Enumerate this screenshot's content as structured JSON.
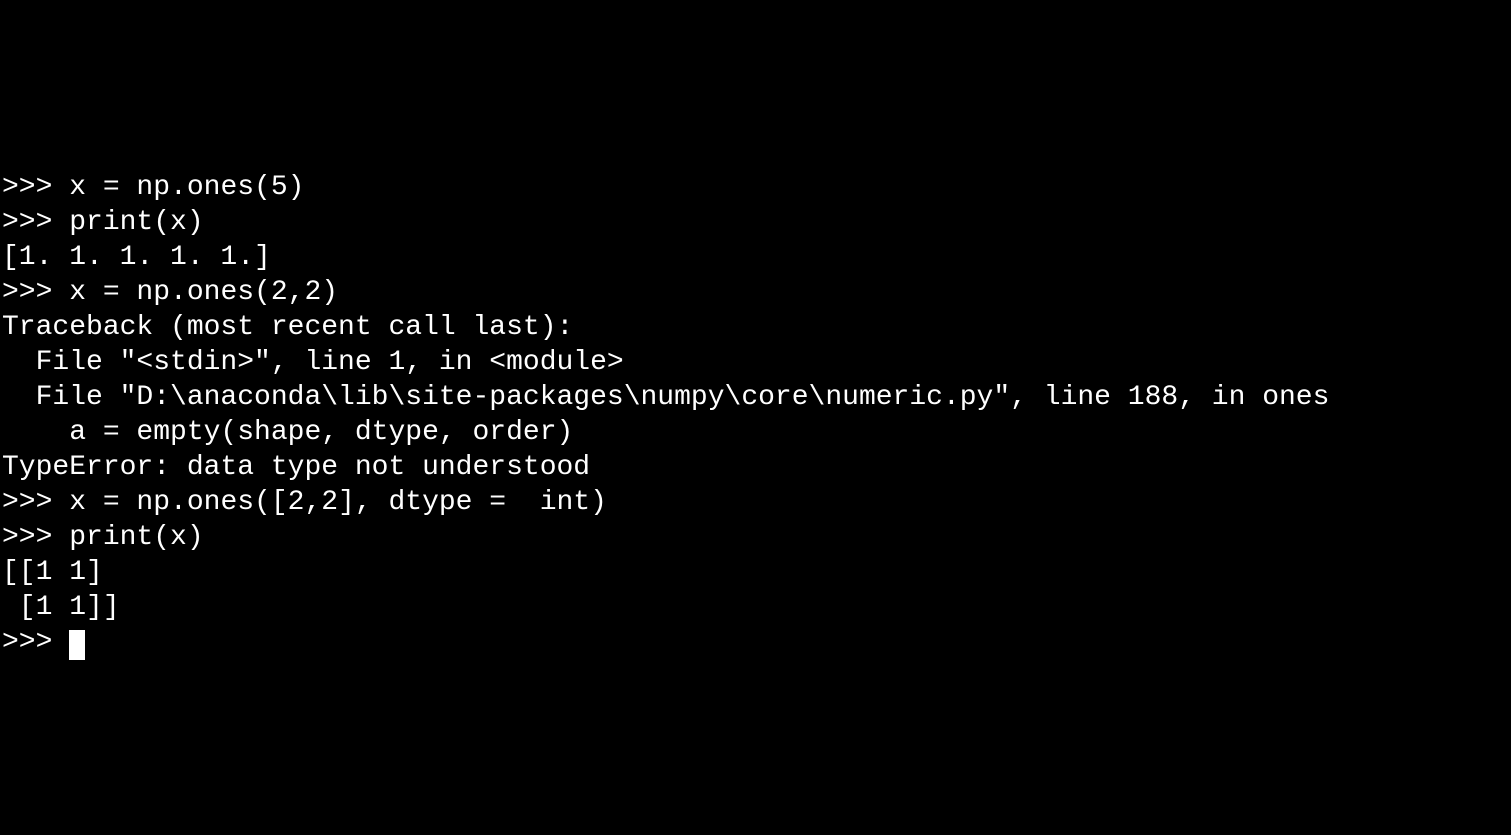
{
  "terminal": {
    "prompt": ">>> ",
    "lines": [
      {
        "type": "input",
        "text": "x = np.ones(5)"
      },
      {
        "type": "input",
        "text": "print(x)"
      },
      {
        "type": "output",
        "text": "[1. 1. 1. 1. 1.]"
      },
      {
        "type": "input",
        "text": "x = np.ones(2,2)"
      },
      {
        "type": "output",
        "text": "Traceback (most recent call last):"
      },
      {
        "type": "output",
        "text": "  File \"<stdin>\", line 1, in <module>"
      },
      {
        "type": "output",
        "text": "  File \"D:\\anaconda\\lib\\site-packages\\numpy\\core\\numeric.py\", line 188, in ones"
      },
      {
        "type": "output",
        "text": "    a = empty(shape, dtype, order)"
      },
      {
        "type": "output",
        "text": "TypeError: data type not understood"
      },
      {
        "type": "input",
        "text": "x = np.ones([2,2], dtype =  int)"
      },
      {
        "type": "input",
        "text": "print(x)"
      },
      {
        "type": "output",
        "text": "[[1 1]"
      },
      {
        "type": "output",
        "text": " [1 1]]"
      },
      {
        "type": "input_cursor",
        "text": ""
      }
    ]
  }
}
